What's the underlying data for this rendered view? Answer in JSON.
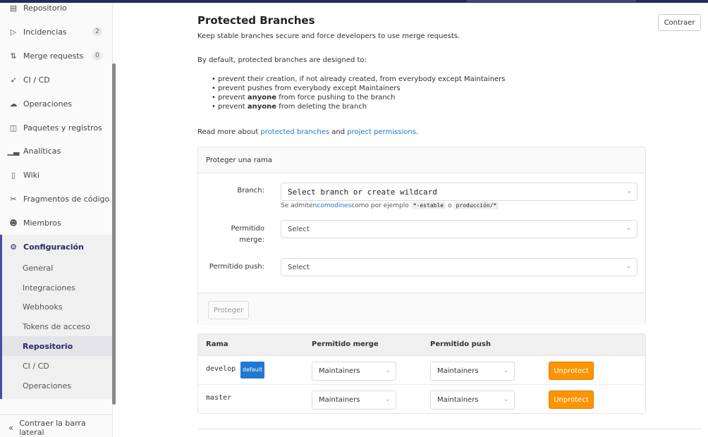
{
  "sidebar": {
    "items": [
      {
        "label": "Repositorio",
        "icon": "document-icon"
      },
      {
        "label": "Incidencias",
        "icon": "issues-icon",
        "count": "2"
      },
      {
        "label": "Merge requests",
        "icon": "merge-request-icon",
        "count": "0"
      },
      {
        "label": "CI / CD",
        "icon": "rocket-icon"
      },
      {
        "label": "Operaciones",
        "icon": "cloud-icon"
      },
      {
        "label": "Paquetes y registros",
        "icon": "package-icon"
      },
      {
        "label": "Analíticas",
        "icon": "chart-icon"
      },
      {
        "label": "Wiki",
        "icon": "book-icon"
      },
      {
        "label": "Fragmentos de código",
        "icon": "scissors-icon"
      },
      {
        "label": "Miembros",
        "icon": "users-icon"
      }
    ],
    "settings": {
      "label": "Configuración",
      "icon": "gear-icon",
      "subitems": [
        "General",
        "Integraciones",
        "Webhooks",
        "Tokens de acceso",
        "Repositorio",
        "CI / CD",
        "Operaciones"
      ],
      "active": "Repositorio"
    },
    "collapse_label": "Contraer la barra lateral"
  },
  "main": {
    "title": "Protected Branches",
    "subtitle": "Keep stable branches secure and force developers to use merge requests.",
    "collapse_button": "Contraer",
    "intro": "By default, protected branches are designed to:",
    "bullets": [
      {
        "pre": "prevent their creation, if not already created, from everybody except Maintainers",
        "bold": "",
        "post": ""
      },
      {
        "pre": "prevent pushes from everybody except Maintainers",
        "bold": "",
        "post": ""
      },
      {
        "pre": "prevent ",
        "bold": "anyone",
        "post": " from force pushing to the branch"
      },
      {
        "pre": "prevent ",
        "bold": "anyone",
        "post": " from deleting the branch"
      }
    ],
    "read_more": {
      "pre": "Read more about ",
      "link1": "protected branches",
      "mid": " and ",
      "link2": "project permissions",
      "post": "."
    }
  },
  "form": {
    "heading": "Proteger una rama",
    "branch_label": "Branch:",
    "branch_placeholder": "Select branch or create wildcard",
    "hint_pre": "Se admiten",
    "hint_link": "comodines",
    "hint_mid": " como por ejemplo ",
    "hint_code1": "*-estable",
    "hint_or": " o ",
    "hint_code2": "producción/*",
    "merge_label_1": "Permitido",
    "merge_label_2": "merge:",
    "merge_value": "Select",
    "push_label": "Permitido push:",
    "push_value": "Select",
    "submit": "Proteger"
  },
  "table": {
    "headers": [
      "Rama",
      "Permitido merge",
      "Permitido push"
    ],
    "rows": [
      {
        "branch": "develop",
        "badge": "default",
        "merge": "Maintainers",
        "push": "Maintainers",
        "action": "Unprotect"
      },
      {
        "branch": "master",
        "badge": "",
        "merge": "Maintainers",
        "push": "Maintainers",
        "action": "Unprotect"
      }
    ]
  },
  "colors": {
    "accent": "#292961",
    "link": "#1f78d1",
    "warning": "#fc9403"
  }
}
